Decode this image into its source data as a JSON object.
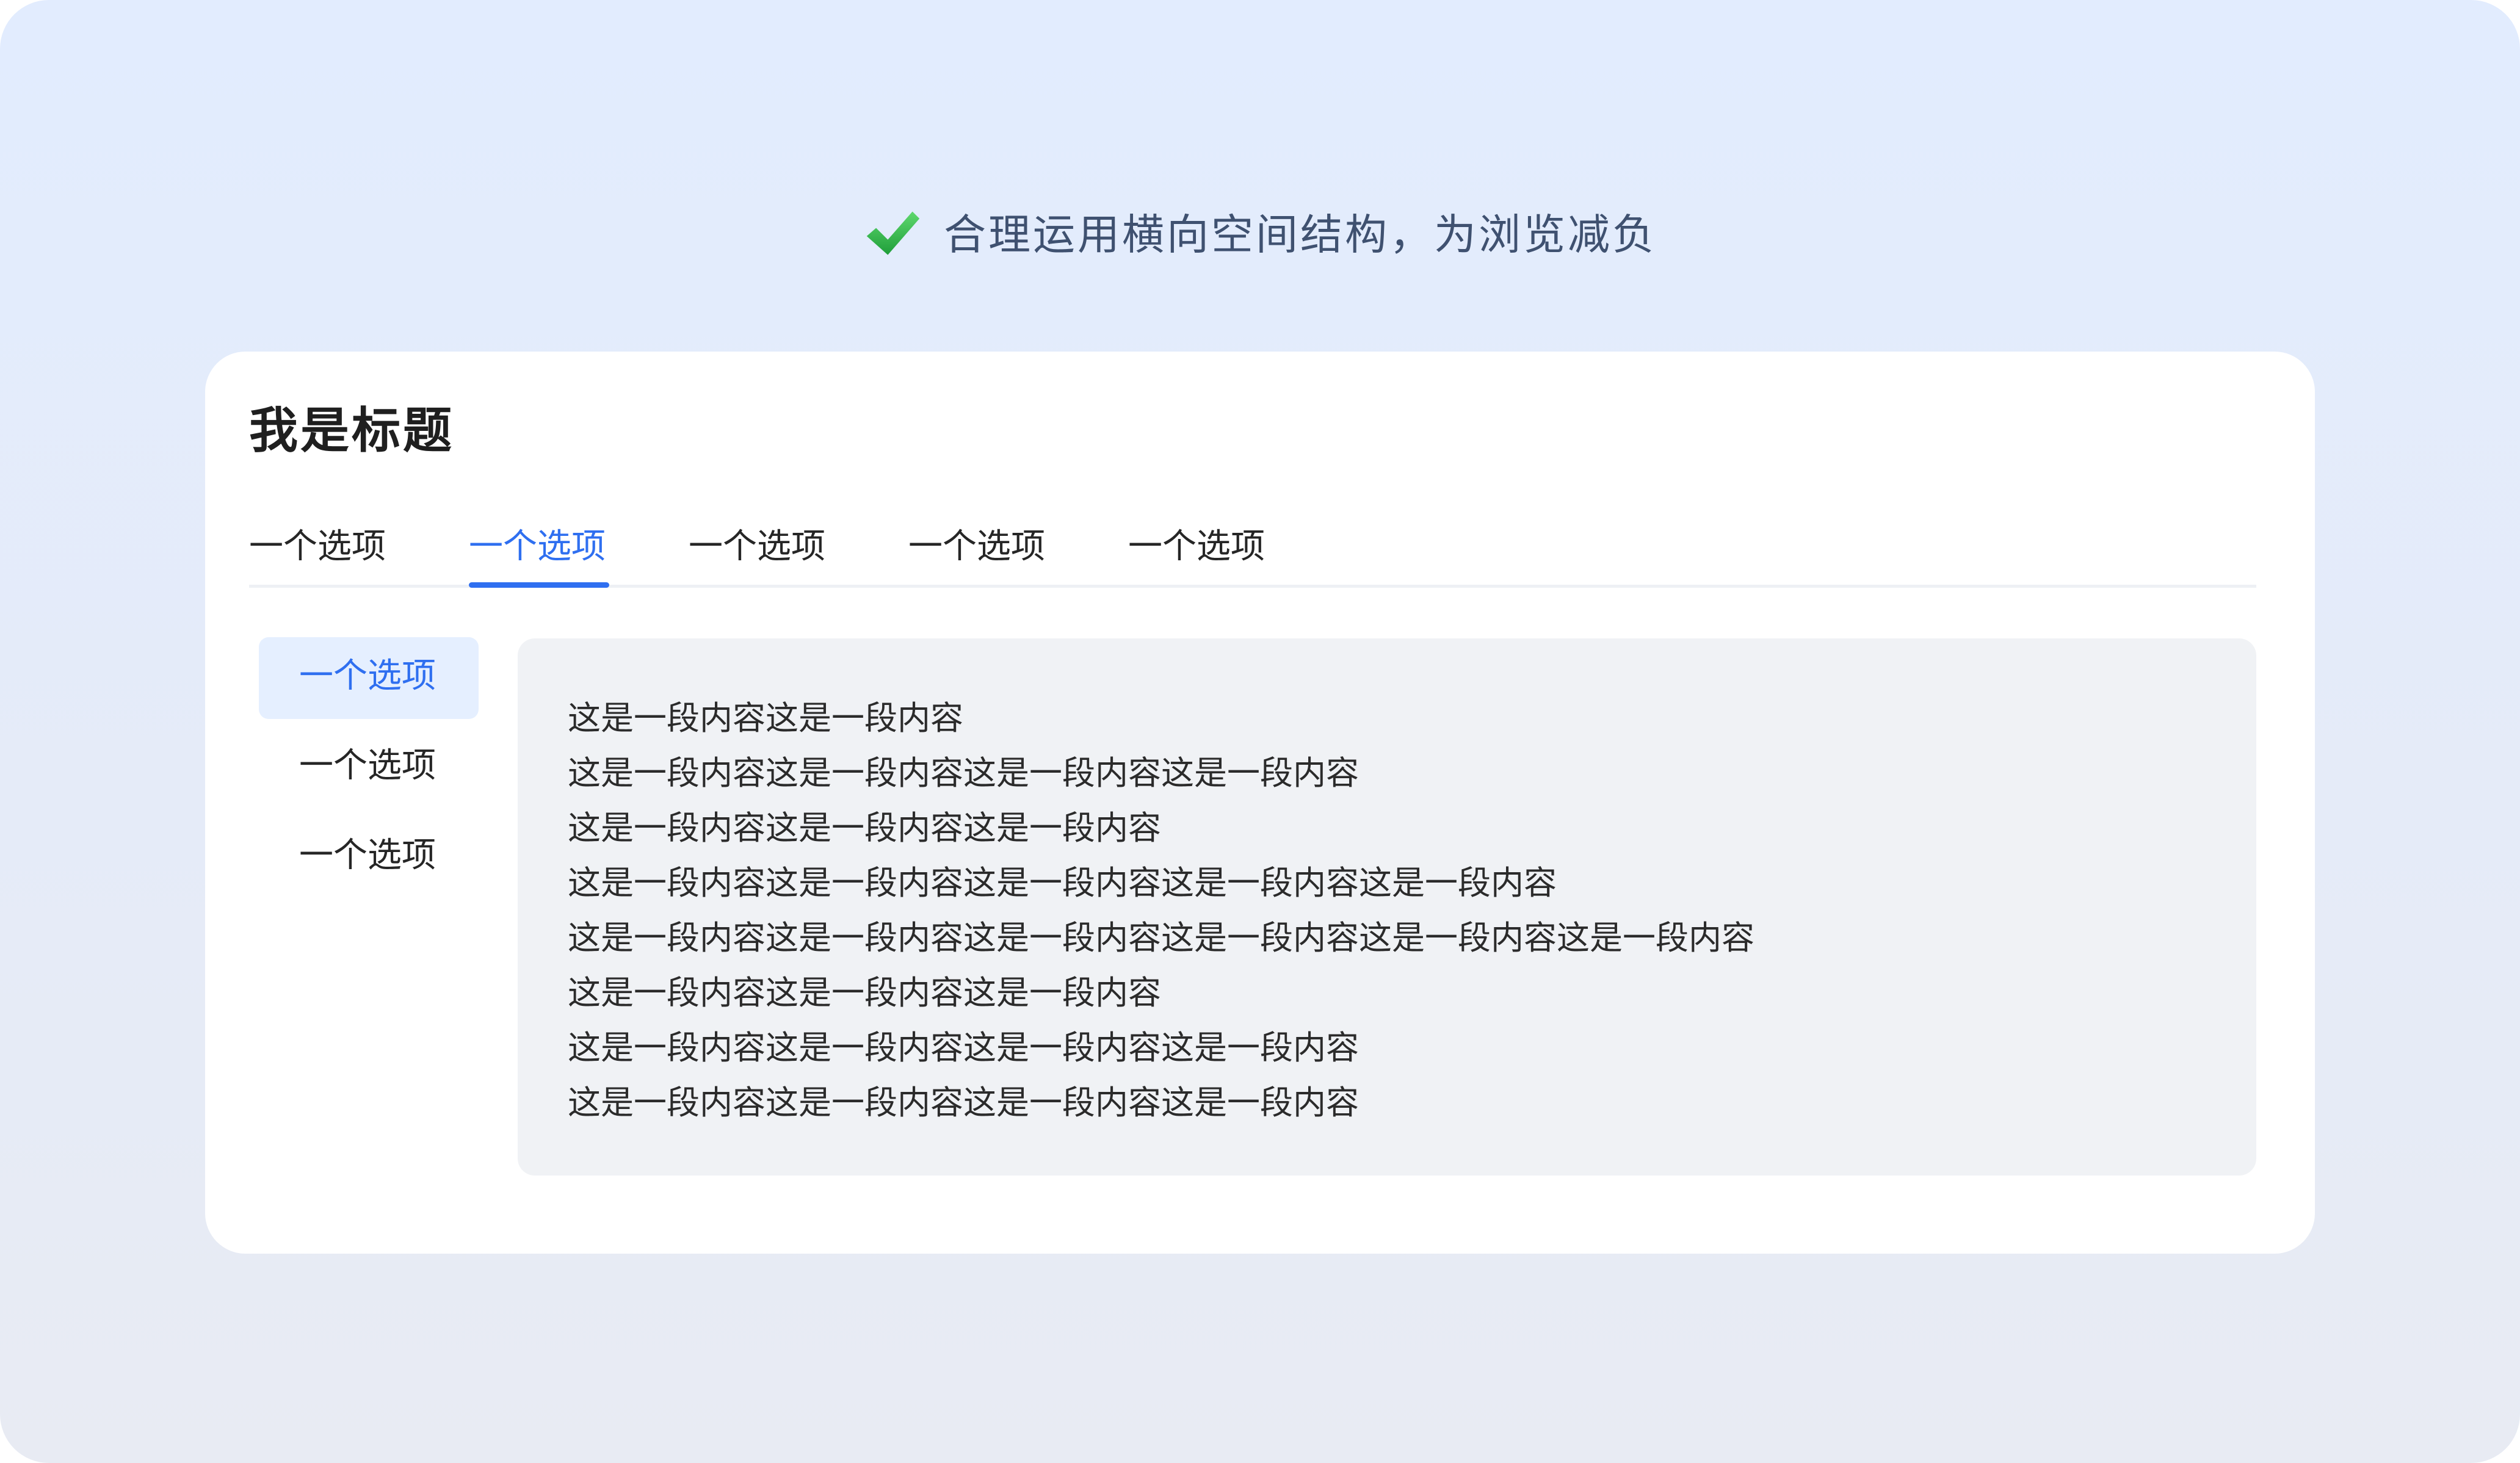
{
  "headline": {
    "icon": "check-icon",
    "icon_color": "#2db84d",
    "text": "合理运用横向空间结构，为浏览减负"
  },
  "card": {
    "title": "我是标题",
    "tabs": [
      {
        "label": "一个选项",
        "active": false
      },
      {
        "label": "一个选项",
        "active": true
      },
      {
        "label": "一个选项",
        "active": false
      },
      {
        "label": "一个选项",
        "active": false
      },
      {
        "label": "一个选项",
        "active": false
      }
    ],
    "side_items": [
      {
        "label": "一个选项",
        "active": true
      },
      {
        "label": "一个选项",
        "active": false
      },
      {
        "label": "一个选项",
        "active": false
      }
    ],
    "content_lines": [
      "这是一段内容这是一段内容",
      "这是一段内容这是一段内容这是一段内容这是一段内容",
      "这是一段内容这是一段内容这是一段内容",
      "这是一段内容这是一段内容这是一段内容这是一段内容这是一段内容",
      "这是一段内容这是一段内容这是一段内容这是一段内容这是一段内容这是一段内容",
      "这是一段内容这是一段内容这是一段内容",
      "这是一段内容这是一段内容这是一段内容这是一段内容",
      "这是一段内容这是一段内容这是一段内容这是一段内容"
    ]
  },
  "colors": {
    "accent": "#2f6ff0",
    "active_side_bg": "#e5efff",
    "content_bg": "#f0f2f5"
  }
}
